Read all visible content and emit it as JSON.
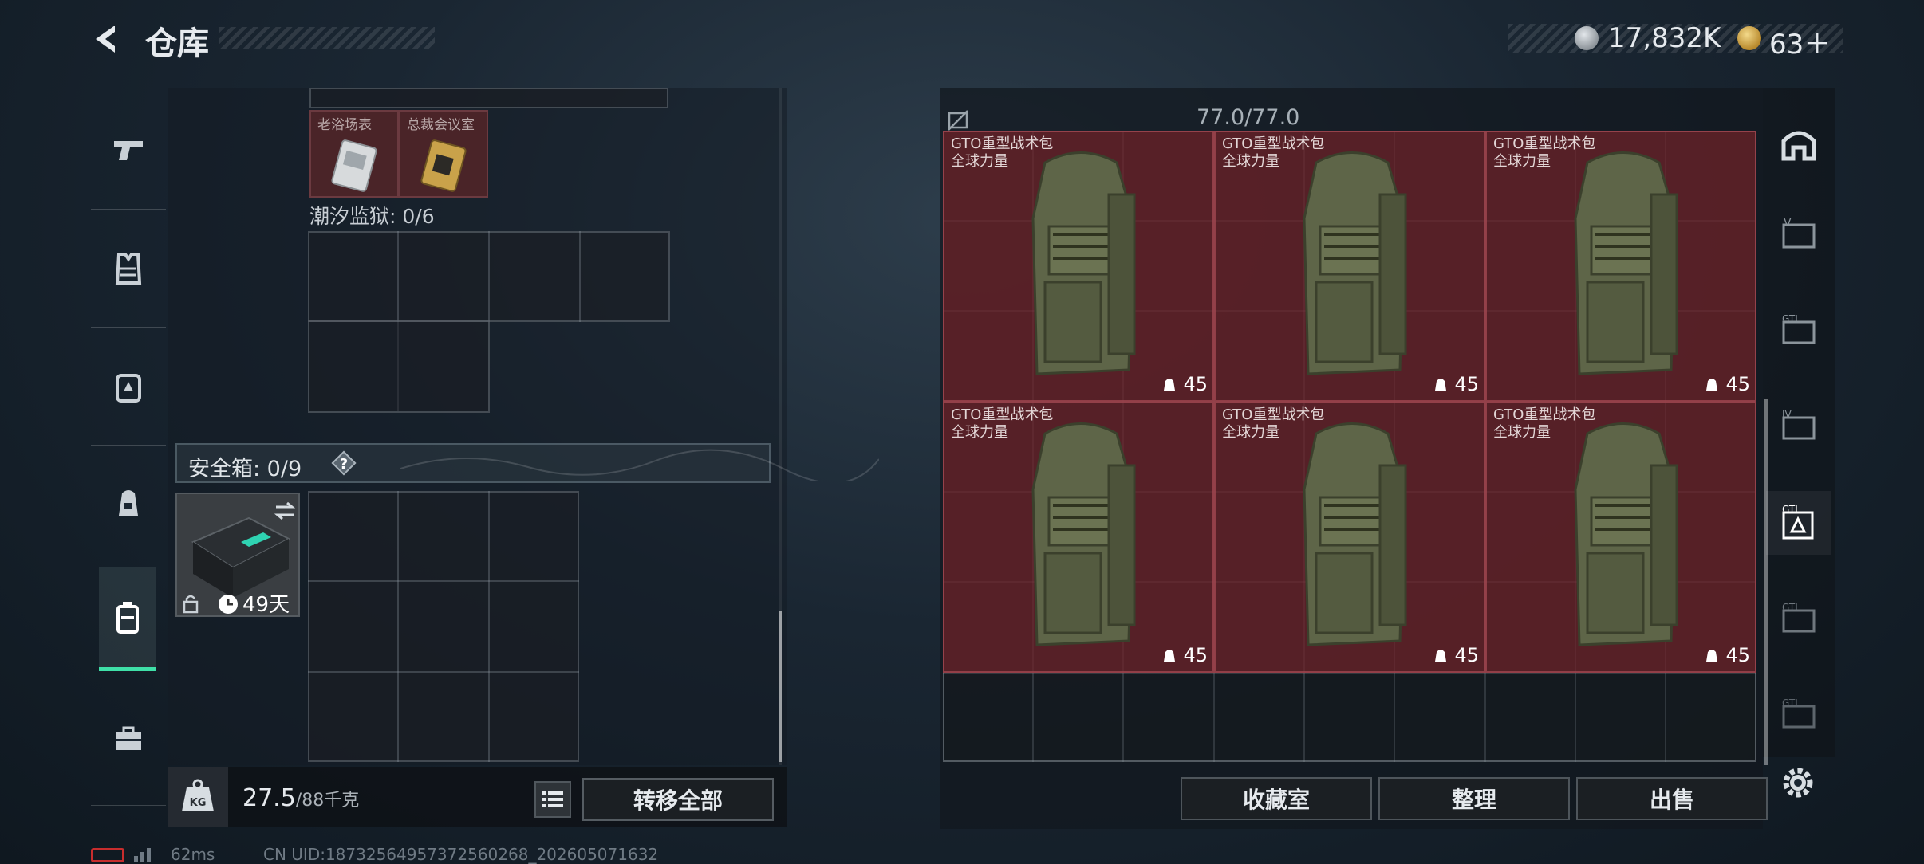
{
  "header": {
    "title": "仓库",
    "currency_a": "17,832K",
    "currency_b": "63＋"
  },
  "left_panel": {
    "key_cards": [
      {
        "label": "老浴场表"
      },
      {
        "label": "总裁会议室"
      }
    ],
    "tide_prison_label": "潮汐监狱: 0/6",
    "safebox_label": "安全箱: 0/9",
    "safebox_days": "49天",
    "weight_value": "27.5",
    "weight_capacity": "/88千克",
    "transfer_all": "转移全部"
  },
  "right_panel": {
    "capacity": "77.0/77.0",
    "backpacks": [
      {
        "name": "GTO重型战术包",
        "sub": "全球力量",
        "count": "45"
      },
      {
        "name": "GTO重型战术包",
        "sub": "全球力量",
        "count": "45"
      },
      {
        "name": "GTO重型战术包",
        "sub": "全球力量",
        "count": "45"
      },
      {
        "name": "GTO重型战术包",
        "sub": "全球力量",
        "count": "45"
      },
      {
        "name": "GTO重型战术包",
        "sub": "全球力量",
        "count": "45"
      },
      {
        "name": "GTO重型战术包",
        "sub": "全球力量",
        "count": "45"
      }
    ],
    "buttons": {
      "collection": "收藏室",
      "organize": "整理",
      "sell": "出售"
    }
  },
  "status": {
    "ping": "62ms",
    "uid": "CN UID:18732564957372560268_202605071632"
  },
  "icons": {
    "left_rail": [
      "pistol-icon",
      "vest-icon",
      "backpack-armor-icon",
      "backpack-icon",
      "container-icon",
      "toolbox-icon"
    ],
    "right_rail": [
      "arch-icon",
      "gti-v-icon",
      "gti-i-icon",
      "gti-iv-icon",
      "gti-active-icon",
      "gti-hand-icon",
      "gti-last-icon"
    ]
  },
  "colors": {
    "accent": "#3fe0a8",
    "backpack_bg": "#70222a",
    "battery_low": "#c72d2d"
  }
}
